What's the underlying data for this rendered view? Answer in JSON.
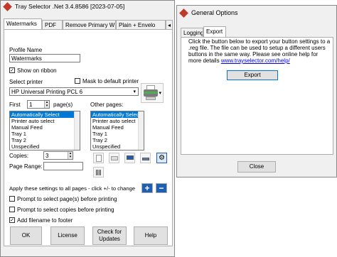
{
  "main_window": {
    "title": "Tray Selector .Net 3.4.8586 [2023-07-05]",
    "tabs": [
      "Watermarks",
      "PDF",
      "Remove Primary W",
      "Plain + Envelo"
    ],
    "profile_name_label": "Profile Name",
    "profile_name_value": "Watermarks",
    "show_on_ribbon_label": "Show on ribbon",
    "select_printer_label": "Select printer",
    "mask_default_label": "Mask to default printer",
    "printer_value": "HP Universal Printing PCL 6",
    "first_label": "First",
    "first_value": "1",
    "pages_label": "page(s)",
    "other_pages_label": "Other pages:",
    "tray_options": [
      "Automatically Select",
      "Printer auto select",
      "Manual Feed",
      "Tray 1",
      "Tray 2",
      "Unspecified"
    ],
    "copies_label": "Copies:",
    "copies_value": "3",
    "page_range_label": "Page Range:",
    "apply_label": "Apply these settings to all pages - click +/- to change",
    "prompt_pages_label": "Prompt to select page(s) before printing",
    "prompt_copies_label": "Prompt to select copies before printing",
    "add_filename_label": "Add filename to footer",
    "buttons": {
      "ok": "OK",
      "license": "License",
      "updates": "Check for Updates",
      "help": "Help"
    },
    "plus": "+",
    "minus": "−",
    "check_mark": "✓"
  },
  "options_window": {
    "title": "General Options",
    "tabs": [
      "Logging",
      "Export"
    ],
    "description": "Click the button below to export your button settings to a .reg file. The file can be used to setup a different users buttons in the same way.  Please see online help for more details",
    "link": "www.trayselector.com/help/",
    "export_button": "Export",
    "close_button": "Close"
  },
  "colors": {
    "selection": "#0078d7",
    "accent_blue": "#1e5fb4",
    "link": "#0000ee",
    "title_icon": "#c0392b"
  }
}
